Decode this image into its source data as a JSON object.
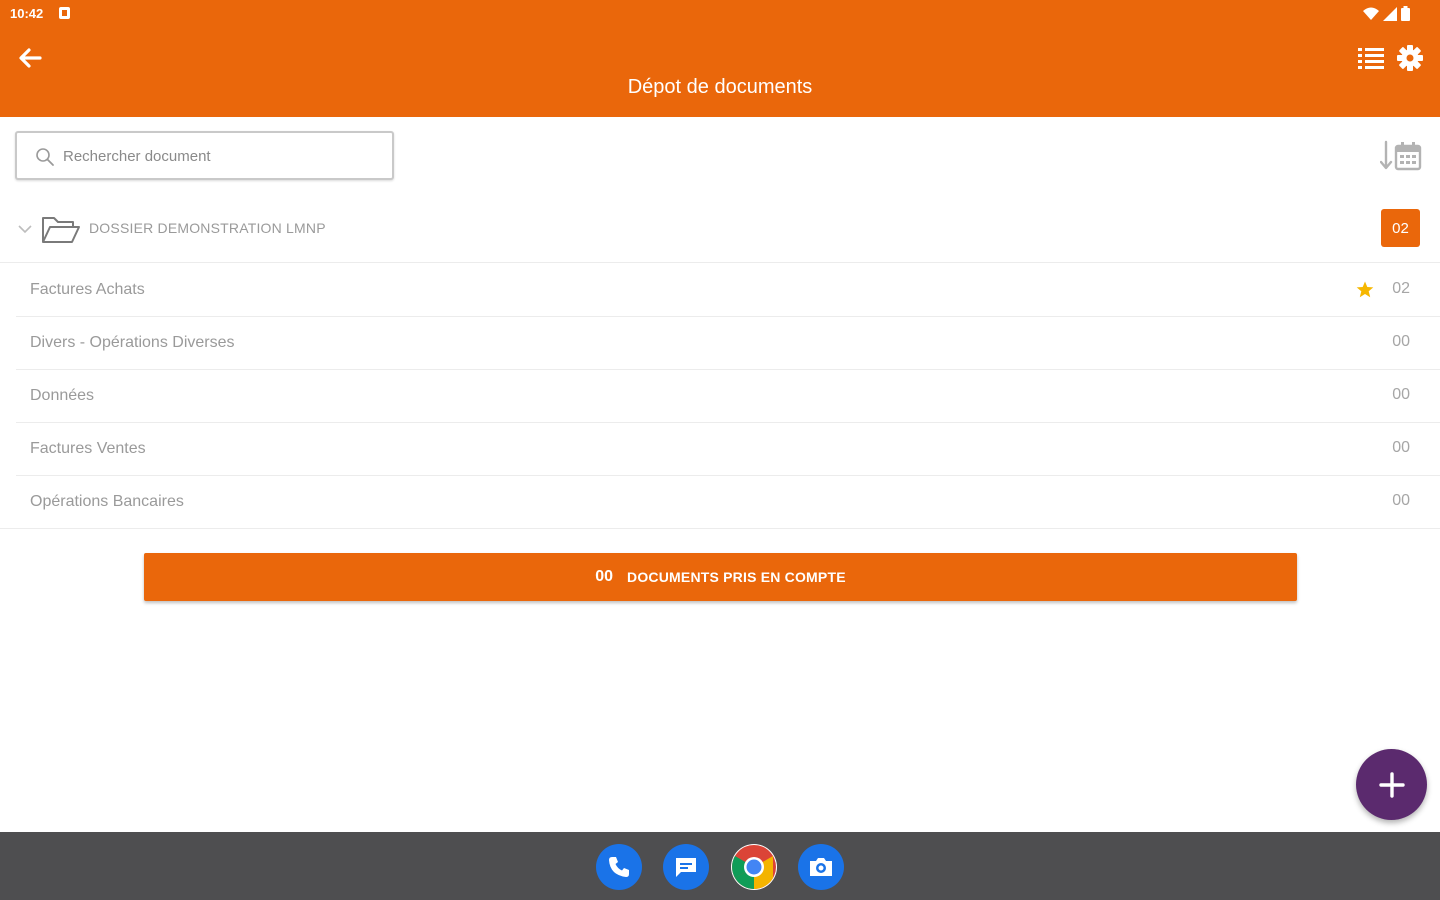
{
  "status_bar": {
    "time": "10:42"
  },
  "header": {
    "title": "Dépot de documents"
  },
  "search": {
    "placeholder": "Rechercher document"
  },
  "folder": {
    "name": "DOSSIER DEMONSTRATION LMNP",
    "count": "02"
  },
  "categories": [
    {
      "name": "Factures Achats",
      "count": "02",
      "starred": true
    },
    {
      "name": "Divers - Opérations Diverses",
      "count": "00"
    },
    {
      "name": "Données",
      "count": "00"
    },
    {
      "name": "Factures Ventes",
      "count": "00"
    },
    {
      "name": "Opérations Bancaires",
      "count": "00"
    }
  ],
  "documents_button": {
    "count": "00",
    "label": "DOCUMENTS PRIS EN COMPTE"
  },
  "colors": {
    "accent": "#EA670B",
    "fab": "#5B2A6E",
    "star": "#F6B700",
    "dock": "#4E4E50"
  },
  "dock_apps": [
    "phone-icon",
    "messages-icon",
    "chrome-icon",
    "camera-icon"
  ]
}
